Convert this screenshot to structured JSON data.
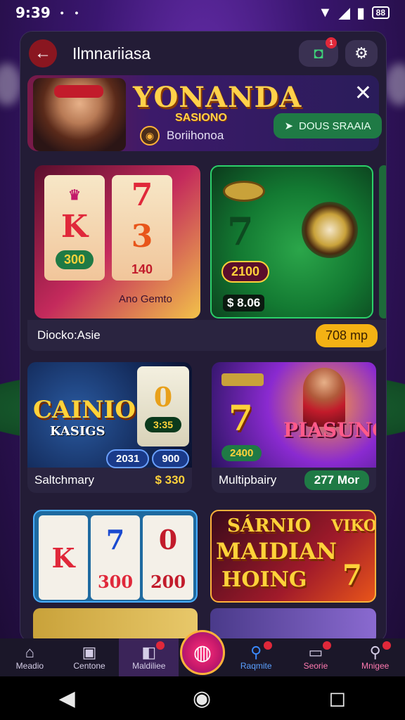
{
  "status": {
    "time": "9:39",
    "dots": "• •",
    "battery": "88"
  },
  "topbar": {
    "title": "Ilmnariiasa",
    "notif_badge": "1"
  },
  "banner": {
    "logo_main": "YONANDA",
    "logo_sub": "SASIONO",
    "subtitle": "Boriihonoa",
    "download_label": "DOUS SRAAIA"
  },
  "featured": {
    "left": {
      "reel1_top": "7",
      "reel1_mid": "K",
      "reel2_mid": "3",
      "pill1": "300",
      "pill2": "140",
      "footer": "Ano Gemto"
    },
    "right": {
      "center": "7",
      "pill": "2100",
      "price": "$ 8.06"
    },
    "caption": "Diocko:Asie",
    "amount": "708 mp"
  },
  "cards": [
    {
      "title_line1": "CAINIO",
      "title_line2": "KASIGS",
      "reel_top": "0",
      "reel_mid": "3:35",
      "pill1": "2031",
      "pill2": "900",
      "caption": "Saltchmary",
      "amount": "$ 330"
    },
    {
      "logo": "PIASUNO",
      "number": "7",
      "pill": "2400",
      "caption": "Multipbairy",
      "amount": "277 Mor"
    }
  ],
  "row3": [
    {
      "r1": "K",
      "r2": "7",
      "r3": "0",
      "v1": "300",
      "v2": "200"
    },
    {
      "line1": "SÁRNIO",
      "line2": "MAIDIAN",
      "line3": "HOING",
      "side": "VIKO",
      "num": "7"
    }
  ],
  "bottom_nav": [
    {
      "label": "Meadio",
      "icon": "home-icon"
    },
    {
      "label": "Centone",
      "icon": "briefcase-icon"
    },
    {
      "label": "Maldiliee",
      "icon": "bag-icon"
    },
    {
      "label": "Raqmite",
      "icon": "search-icon"
    },
    {
      "label": "Seorie",
      "icon": "monitor-icon"
    },
    {
      "label": "Mnigee",
      "icon": "zoom-icon"
    }
  ]
}
